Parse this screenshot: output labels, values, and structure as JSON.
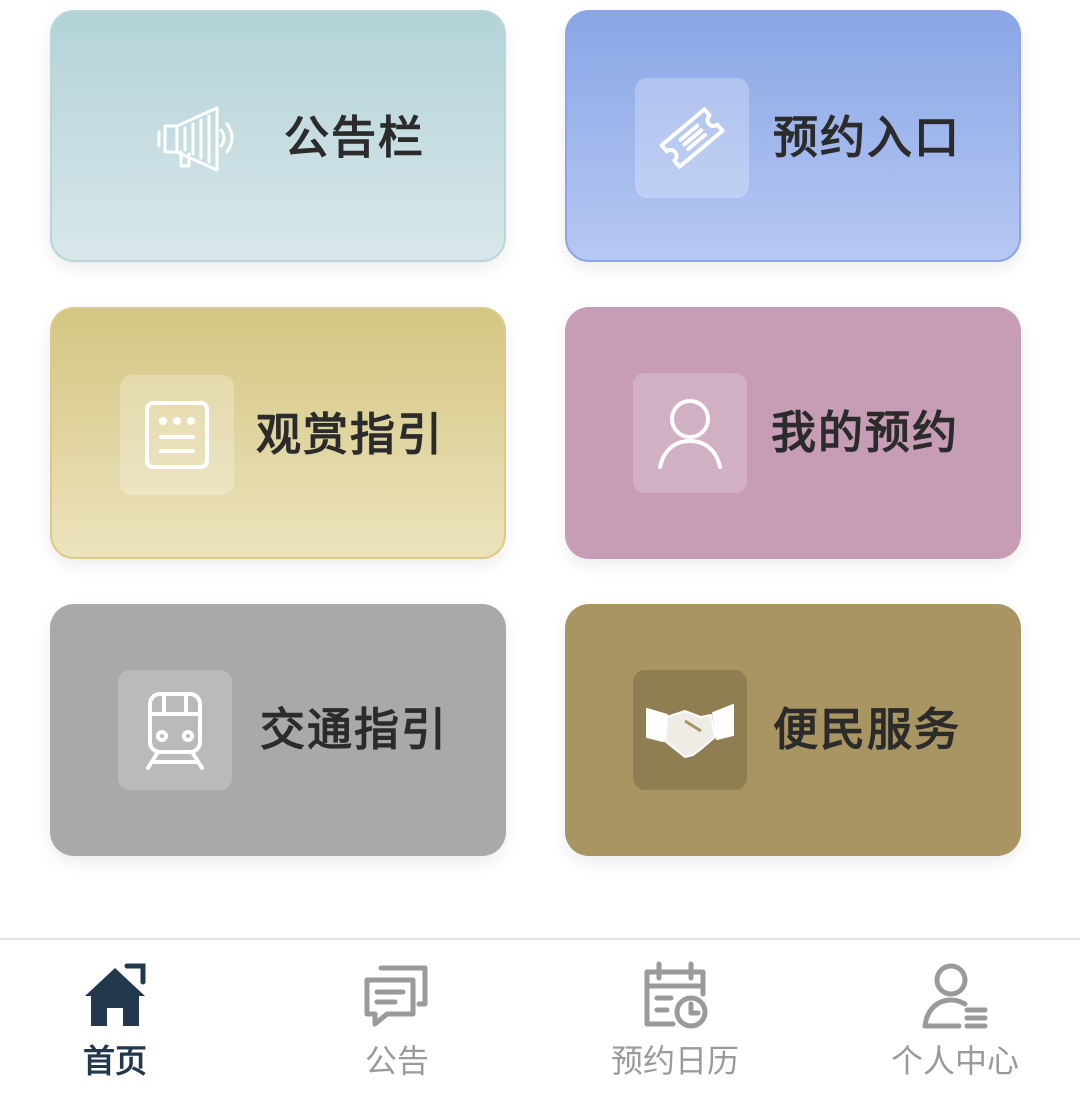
{
  "tiles": [
    {
      "id": "notice",
      "label": "公告栏",
      "icon": "megaphone-icon"
    },
    {
      "id": "booking",
      "label": "预约入口",
      "icon": "ticket-icon"
    },
    {
      "id": "guide",
      "label": "观赏指引",
      "icon": "document-icon"
    },
    {
      "id": "mine",
      "label": "我的预约",
      "icon": "user-icon"
    },
    {
      "id": "traffic",
      "label": "交通指引",
      "icon": "train-icon"
    },
    {
      "id": "service",
      "label": "便民服务",
      "icon": "handshake-icon"
    }
  ],
  "tabbar": {
    "active_color": "#22394d",
    "inactive_color": "#9a9a9a",
    "items": [
      {
        "label": "首页",
        "icon": "home-icon",
        "active": true
      },
      {
        "label": "公告",
        "icon": "message-icon",
        "active": false
      },
      {
        "label": "预约日历",
        "icon": "calendar-icon",
        "active": false
      },
      {
        "label": "个人中心",
        "icon": "profile-icon",
        "active": false
      }
    ]
  }
}
